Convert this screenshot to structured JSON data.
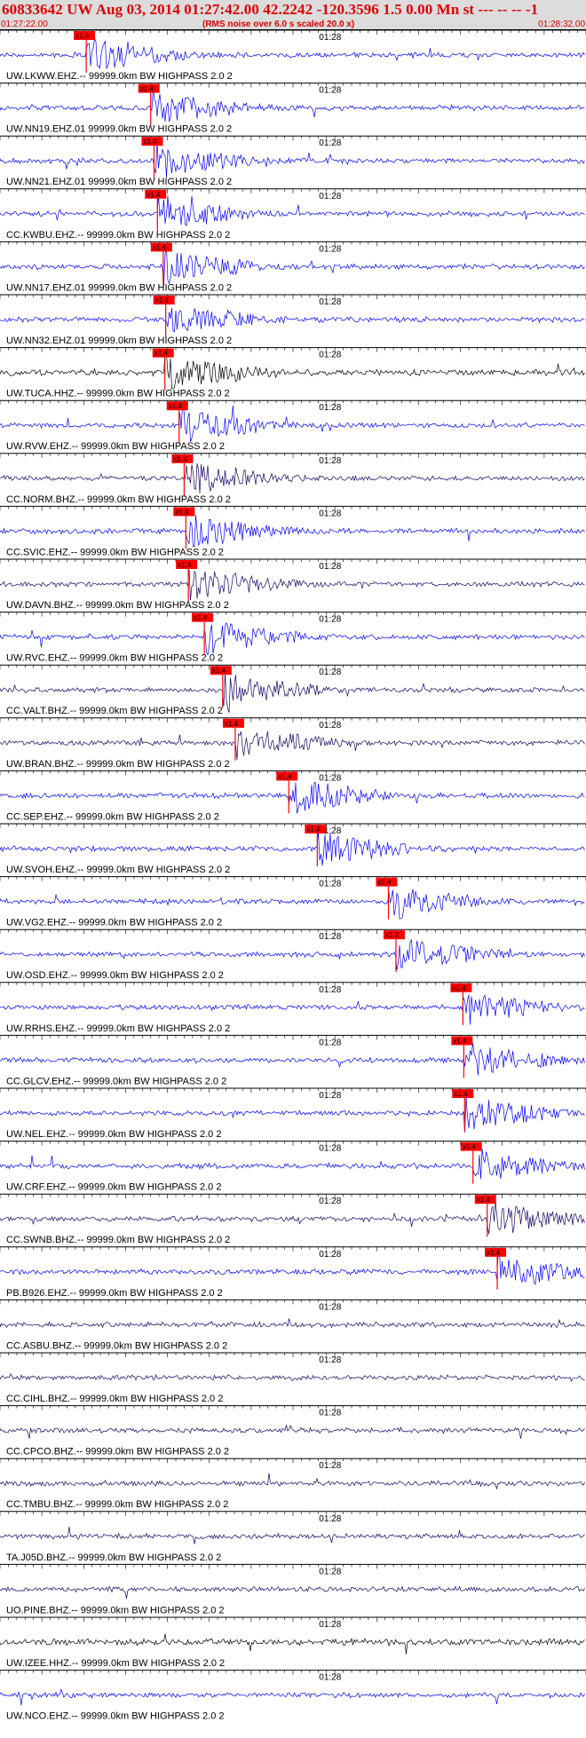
{
  "header": {
    "title": "60833642 UW Aug 03, 2014 01:27:42.00   42.2242 -120.3596  1.5 0.00 Mn st --- -- --  -1",
    "start_time": "01:27:22.00",
    "end_time": "01:28:32.00",
    "scale_note": "(RMS noise over 6.0 s scaled 20.0 x)"
  },
  "colors": {
    "trace_blue": "#0000ff",
    "trace_navy": "#1a0066",
    "trace_black": "#000000",
    "pick": "#ff0000",
    "header_bg": "#dcdcdc"
  },
  "chart_data": {
    "type": "line",
    "title": "60833642 UW Aug 03, 2014 01:27:42.00   42.2242 -120.3596  1.5 0.00 Mn st --- -- --  -1",
    "x_range": [
      "01:27:22.00",
      "01:28:32.00"
    ],
    "x_mid_label": "01:28",
    "pick_label": "x1.4",
    "grid": false,
    "series": [
      {
        "name": "UW.LKWW.EHZ.--  99999.0km BW  HIGHPASS  2.0  2",
        "color": "blue",
        "pick_s": 10.3
      },
      {
        "name": "UW.NN19.EHZ.01  99999.0km BW  HIGHPASS  2.0  2",
        "color": "blue",
        "pick_s": 18.0
      },
      {
        "name": "UW.NN21.EHZ.01  99999.0km BW  HIGHPASS  2.0  2",
        "color": "blue",
        "pick_s": 18.4
      },
      {
        "name": "CC.KWBU.EHZ.--  99999.0km BW  HIGHPASS  2.0  2",
        "color": "blue",
        "pick_s": 18.8
      },
      {
        "name": "UW.NN17.EHZ.01  99999.0km BW  HIGHPASS  2.0  2",
        "color": "blue",
        "pick_s": 19.5
      },
      {
        "name": "UW.NN32.EHZ.01  99999.0km BW  HIGHPASS  2.0  2",
        "color": "blue",
        "pick_s": 19.8
      },
      {
        "name": "UW.TUCA.HHZ.--  99999.0km BW  HIGHPASS  2.0  2",
        "color": "black",
        "pick_s": 19.7
      },
      {
        "name": "UW.RVW.EHZ.--  99999.0km BW  HIGHPASS  2.0  2",
        "color": "blue",
        "pick_s": 21.4
      },
      {
        "name": "CC.NORM.BHZ.--  99999.0km BW  HIGHPASS  2.0  2",
        "color": "navy",
        "pick_s": 22.0
      },
      {
        "name": "CC.SVIC.EHZ.--  99999.0km BW  HIGHPASS  2.0  2",
        "color": "blue",
        "pick_s": 22.2
      },
      {
        "name": "UW.DAVN.BHZ.--  99999.0km BW  HIGHPASS  2.0  2",
        "color": "navy",
        "pick_s": 22.5
      },
      {
        "name": "UW.RVC.EHZ.--  99999.0km BW  HIGHPASS  2.0  2",
        "color": "blue",
        "pick_s": 24.4
      },
      {
        "name": "CC.VALT.BHZ.--  99999.0km BW  HIGHPASS  2.0  2",
        "color": "navy",
        "pick_s": 26.6
      },
      {
        "name": "UW.BRAN.BHZ.--  99999.0km BW  HIGHPASS  2.0  2",
        "color": "navy",
        "pick_s": 28.1
      },
      {
        "name": "CC.SEP.EHZ.--  99999.0km BW  HIGHPASS  2.0  2",
        "color": "blue",
        "pick_s": 34.5
      },
      {
        "name": "UW.SVOH.EHZ.--  99999.0km BW  HIGHPASS  2.0  2",
        "color": "blue",
        "pick_s": 37.9
      },
      {
        "name": "UW.VG2.EHZ.--  99999.0km BW  HIGHPASS  2.0  2",
        "color": "blue",
        "pick_s": 46.4
      },
      {
        "name": "UW.OSD.EHZ.--  99999.0km BW  HIGHPASS  2.0  2",
        "color": "blue",
        "pick_s": 47.3
      },
      {
        "name": "UW.RRHS.EHZ.--  99999.0km BW  HIGHPASS  2.0  2",
        "color": "blue",
        "pick_s": 55.3
      },
      {
        "name": "CC.GLCV.EHZ.--  99999.0km BW  HIGHPASS  2.0  2",
        "color": "blue",
        "pick_s": 55.4
      },
      {
        "name": "UW.NEL.EHZ.--  99999.0km BW  HIGHPASS  2.0  2",
        "color": "blue",
        "pick_s": 55.5
      },
      {
        "name": "UW.CRF.EHZ.--  99999.0km BW  HIGHPASS  2.0  2",
        "color": "blue",
        "pick_s": 56.5
      },
      {
        "name": "CC.SWNB.BHZ.--  99999.0km BW  HIGHPASS  2.0  2",
        "color": "navy",
        "pick_s": 58.2
      },
      {
        "name": "PB.B926.EHZ.--  99999.0km BW  HIGHPASS  2.0  2",
        "color": "blue",
        "pick_s": 59.4
      },
      {
        "name": "CC.ASBU.BHZ.--  99999.0km BW  HIGHPASS  2.0  2",
        "color": "navy",
        "pick_s": null
      },
      {
        "name": "CC.CIHL.BHZ.--  99999.0km BW  HIGHPASS  2.0  2",
        "color": "navy",
        "pick_s": null
      },
      {
        "name": "CC.CPCO.BHZ.--  99999.0km BW  HIGHPASS  2.0  2",
        "color": "navy",
        "pick_s": null
      },
      {
        "name": "CC.TMBU.BHZ.--  99999.0km BW  HIGHPASS  2.0  2",
        "color": "navy",
        "pick_s": null
      },
      {
        "name": "TA.J05D.BHZ.--  99999.0km BW  HIGHPASS  2.0  2",
        "color": "navy",
        "pick_s": null
      },
      {
        "name": "UO.PINE.BHZ.--  99999.0km BW  HIGHPASS  2.0  2",
        "color": "navy",
        "pick_s": null
      },
      {
        "name": "UW.IZEE.HHZ.--  99999.0km BW  HIGHPASS  2.0  2",
        "color": "black",
        "pick_s": null
      },
      {
        "name": "UW.NCO.EHZ.--  99999.0km BW  HIGHPASS  2.0  2",
        "color": "blue",
        "pick_s": null
      }
    ]
  }
}
